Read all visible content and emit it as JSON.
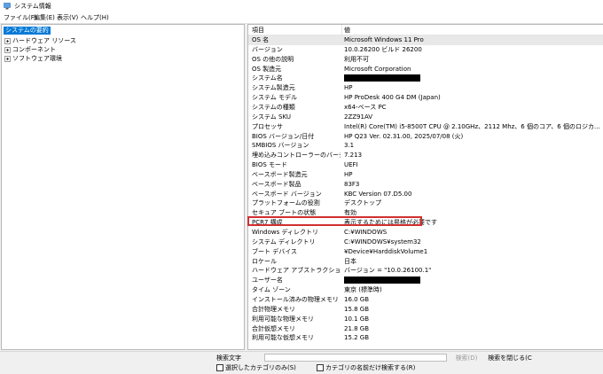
{
  "window": {
    "title": "システム情報"
  },
  "menu": [
    {
      "label": "ファイル(F)"
    },
    {
      "label": "編集(E)"
    },
    {
      "label": "表示(V)"
    },
    {
      "label": "ヘルプ(H)"
    }
  ],
  "tree": {
    "root": "システムの要約",
    "children": [
      {
        "label": "ハードウェア リソース"
      },
      {
        "label": "コンポーネント"
      },
      {
        "label": "ソフトウェア環境"
      }
    ]
  },
  "list": {
    "headers": {
      "item": "項目",
      "value": "値"
    },
    "rows": [
      {
        "name": "OS 名",
        "value": "Microsoft Windows 11 Pro",
        "selected": true
      },
      {
        "name": "バージョン",
        "value": "10.0.26200 ビルド 26200"
      },
      {
        "name": "OS の他の説明",
        "value": "利用不可"
      },
      {
        "name": "OS 製造元",
        "value": "Microsoft Corporation"
      },
      {
        "name": "システム名",
        "value": "",
        "redacted": true
      },
      {
        "name": "システム製造元",
        "value": "HP"
      },
      {
        "name": "システム モデル",
        "value": "HP ProDesk 400 G4 DM (Japan)"
      },
      {
        "name": "システムの種類",
        "value": "x64-ベース PC"
      },
      {
        "name": "システム SKU",
        "value": "2ZZ91AV"
      },
      {
        "name": "プロセッサ",
        "value": "Intel(R) Core(TM) i5-8500T CPU @ 2.10GHz、2112 Mhz、6 個のコア、6 個のロジカ..."
      },
      {
        "name": "BIOS バージョン/日付",
        "value": "HP Q23 Ver. 02.31.00, 2025/07/08 (火)"
      },
      {
        "name": "SMBIOS バージョン",
        "value": "3.1"
      },
      {
        "name": "埋め込みコントローラーのバージョン",
        "value": "7.213"
      },
      {
        "name": "BIOS モード",
        "value": "UEFI"
      },
      {
        "name": "ベースボード製造元",
        "value": "HP"
      },
      {
        "name": "ベースボード製品",
        "value": "83F3"
      },
      {
        "name": "ベースボード バージョン",
        "value": "KBC Version 07.D5.00"
      },
      {
        "name": "プラットフォームの役割",
        "value": "デスクトップ"
      },
      {
        "name": "セキュア ブートの状態",
        "value": "有効",
        "highlighted": true
      },
      {
        "name": "PCR7 構成",
        "value": "表示するためには昇格が必要です"
      },
      {
        "name": "Windows ディレクトリ",
        "value": "C:¥WINDOWS"
      },
      {
        "name": "システム ディレクトリ",
        "value": "C:¥WINDOWS¥system32"
      },
      {
        "name": "ブート デバイス",
        "value": "¥Device¥HarddiskVolume1"
      },
      {
        "name": "ロケール",
        "value": "日本"
      },
      {
        "name": "ハードウェア アブストラクション レイヤー",
        "value": "バージョン = \"10.0.26100.1\""
      },
      {
        "name": "ユーザー名",
        "value": "",
        "redacted": true
      },
      {
        "name": "タイム ゾーン",
        "value": "東京 (標準時)"
      },
      {
        "name": "インストール済みの物理メモリ (RAM)",
        "value": "16.0 GB"
      },
      {
        "name": "合計物理メモリ",
        "value": "15.8 GB"
      },
      {
        "name": "利用可能な物理メモリ",
        "value": "10.1 GB"
      },
      {
        "name": "合計仮想メモリ",
        "value": "21.8 GB"
      },
      {
        "name": "利用可能な仮想メモリ",
        "value": "15.2 GB"
      }
    ]
  },
  "find": {
    "label": "検索文字",
    "input_value": "",
    "find_button": "検索(D)",
    "close_button": "検索を閉じる(C",
    "checkbox_selected": "選択したカテゴリのみ(S)",
    "checkbox_names": "カテゴリの名前だけ検索する(R)"
  },
  "colors": {
    "selection": "#0078d7",
    "highlight": "#d32f2f"
  }
}
